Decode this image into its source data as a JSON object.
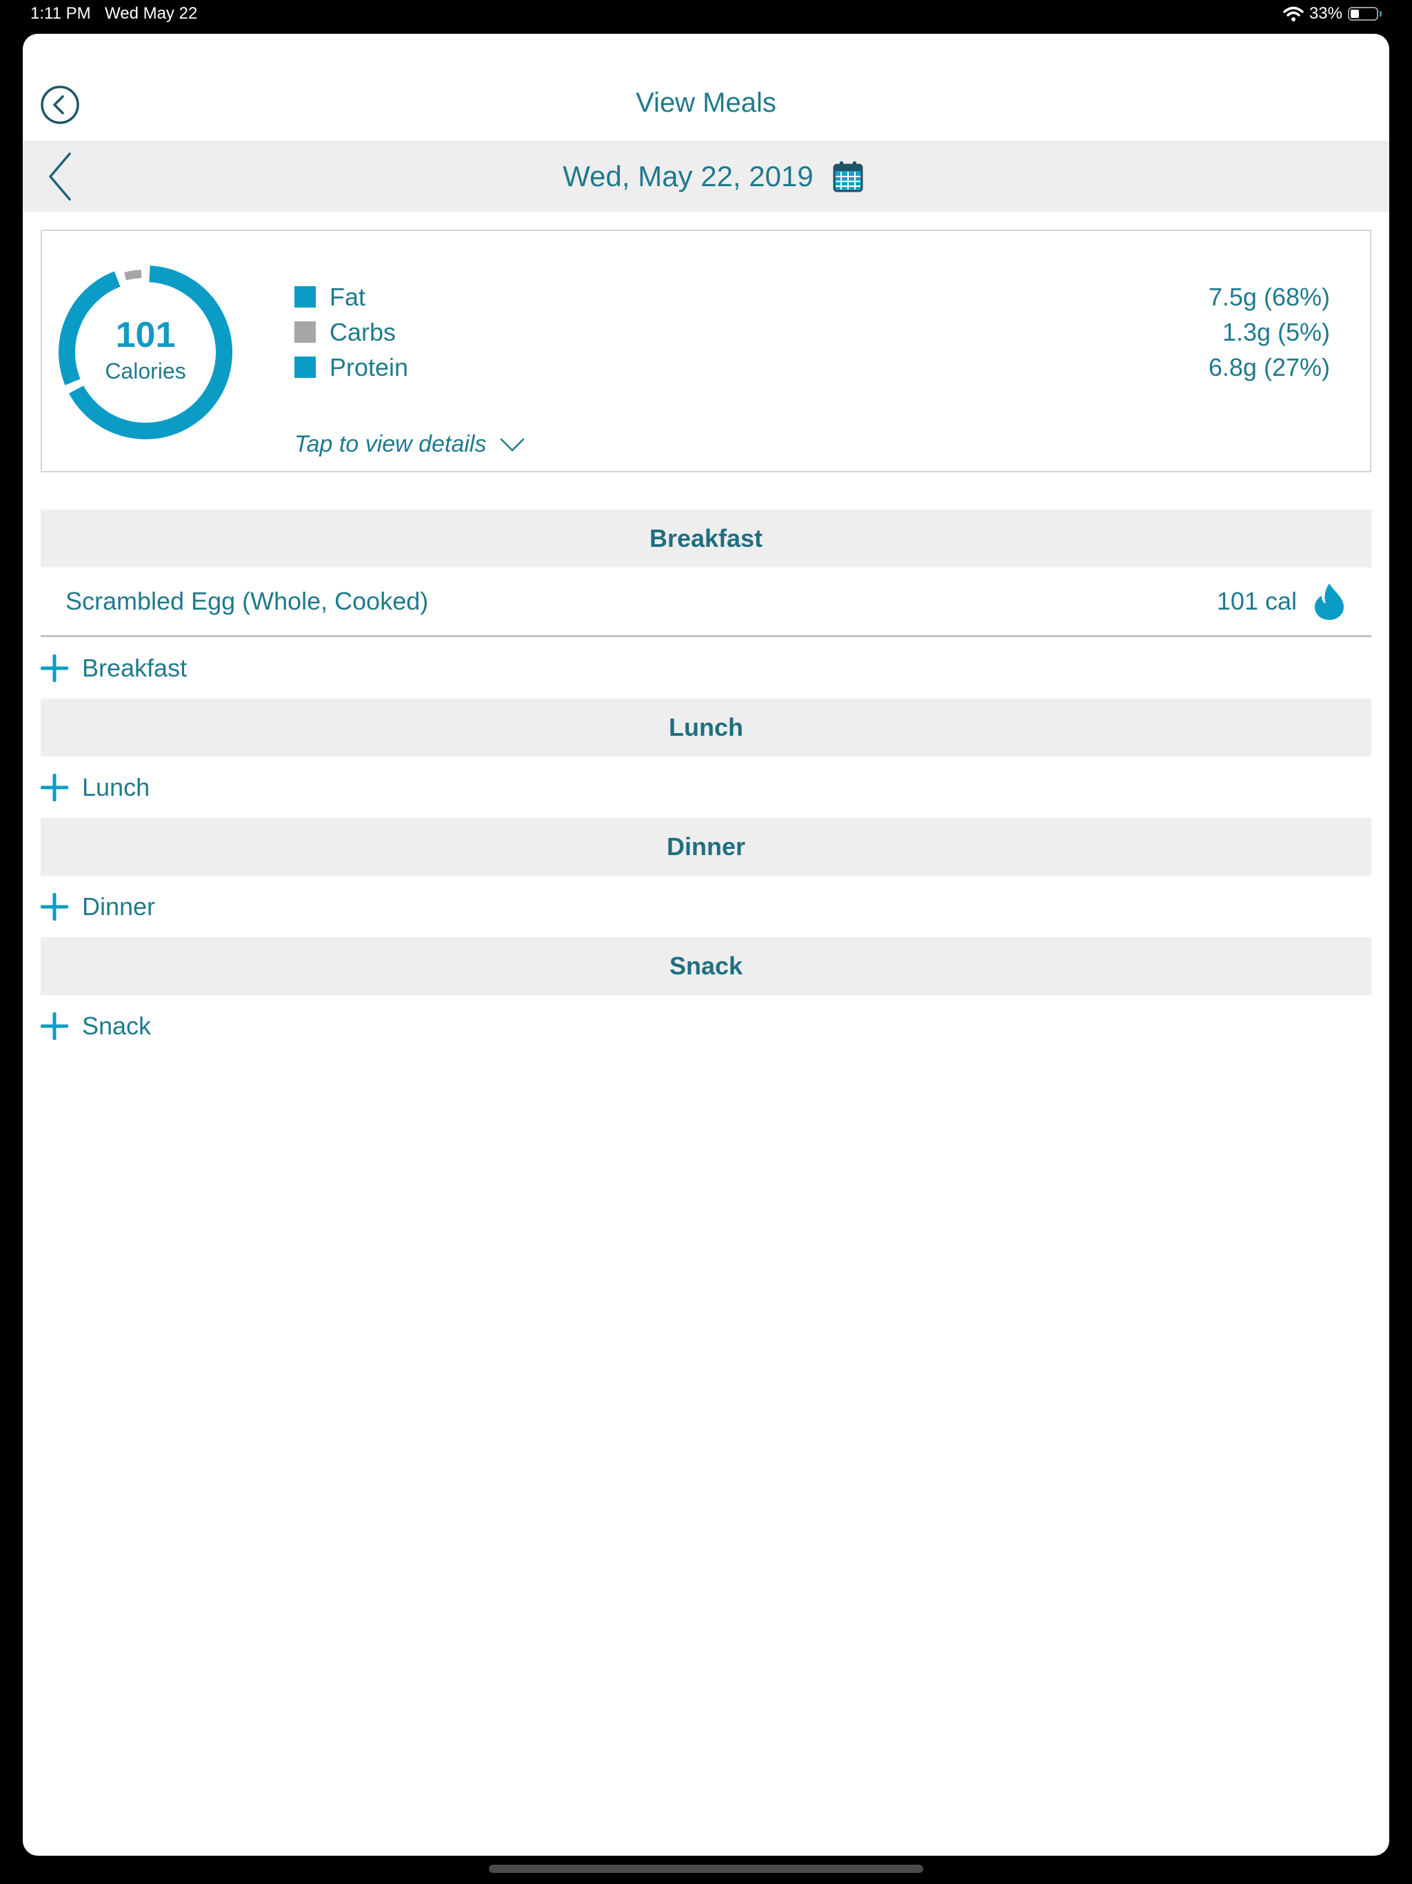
{
  "status_bar": {
    "time": "1:11 PM",
    "date": "Wed May 22",
    "battery_percent": "33%",
    "battery_level": 0.33,
    "wifi_icon": "wifi-icon"
  },
  "header": {
    "title": "View Meals",
    "back_icon": "back-circle-icon"
  },
  "date_nav": {
    "date": "Wed, May 22, 2019",
    "prev_icon": "chevron-left-icon",
    "calendar_icon": "calendar-icon"
  },
  "summary": {
    "calories": "101",
    "calories_label": "Calories",
    "macros": [
      {
        "label": "Fat",
        "value": "7.5g (68%)",
        "percent": 68,
        "color": "#0b9cc6"
      },
      {
        "label": "Carbs",
        "value": "1.3g (5%)",
        "percent": 5,
        "color": "#a6a6a6"
      },
      {
        "label": "Protein",
        "value": "6.8g (27%)",
        "percent": 27,
        "color": "#0b9cc6"
      }
    ],
    "details_label": "Tap to view details"
  },
  "meals": [
    {
      "name": "Breakfast",
      "add_label": "Breakfast",
      "items": [
        {
          "name": "Scrambled Egg (Whole, Cooked)",
          "calories": "101 cal"
        }
      ]
    },
    {
      "name": "Lunch",
      "add_label": "Lunch",
      "items": []
    },
    {
      "name": "Dinner",
      "add_label": "Dinner",
      "items": []
    },
    {
      "name": "Snack",
      "add_label": "Snack",
      "items": []
    }
  ],
  "colors": {
    "accent": "#0b9cc6",
    "text": "#1f7a8c",
    "band": "#eeeeee"
  }
}
